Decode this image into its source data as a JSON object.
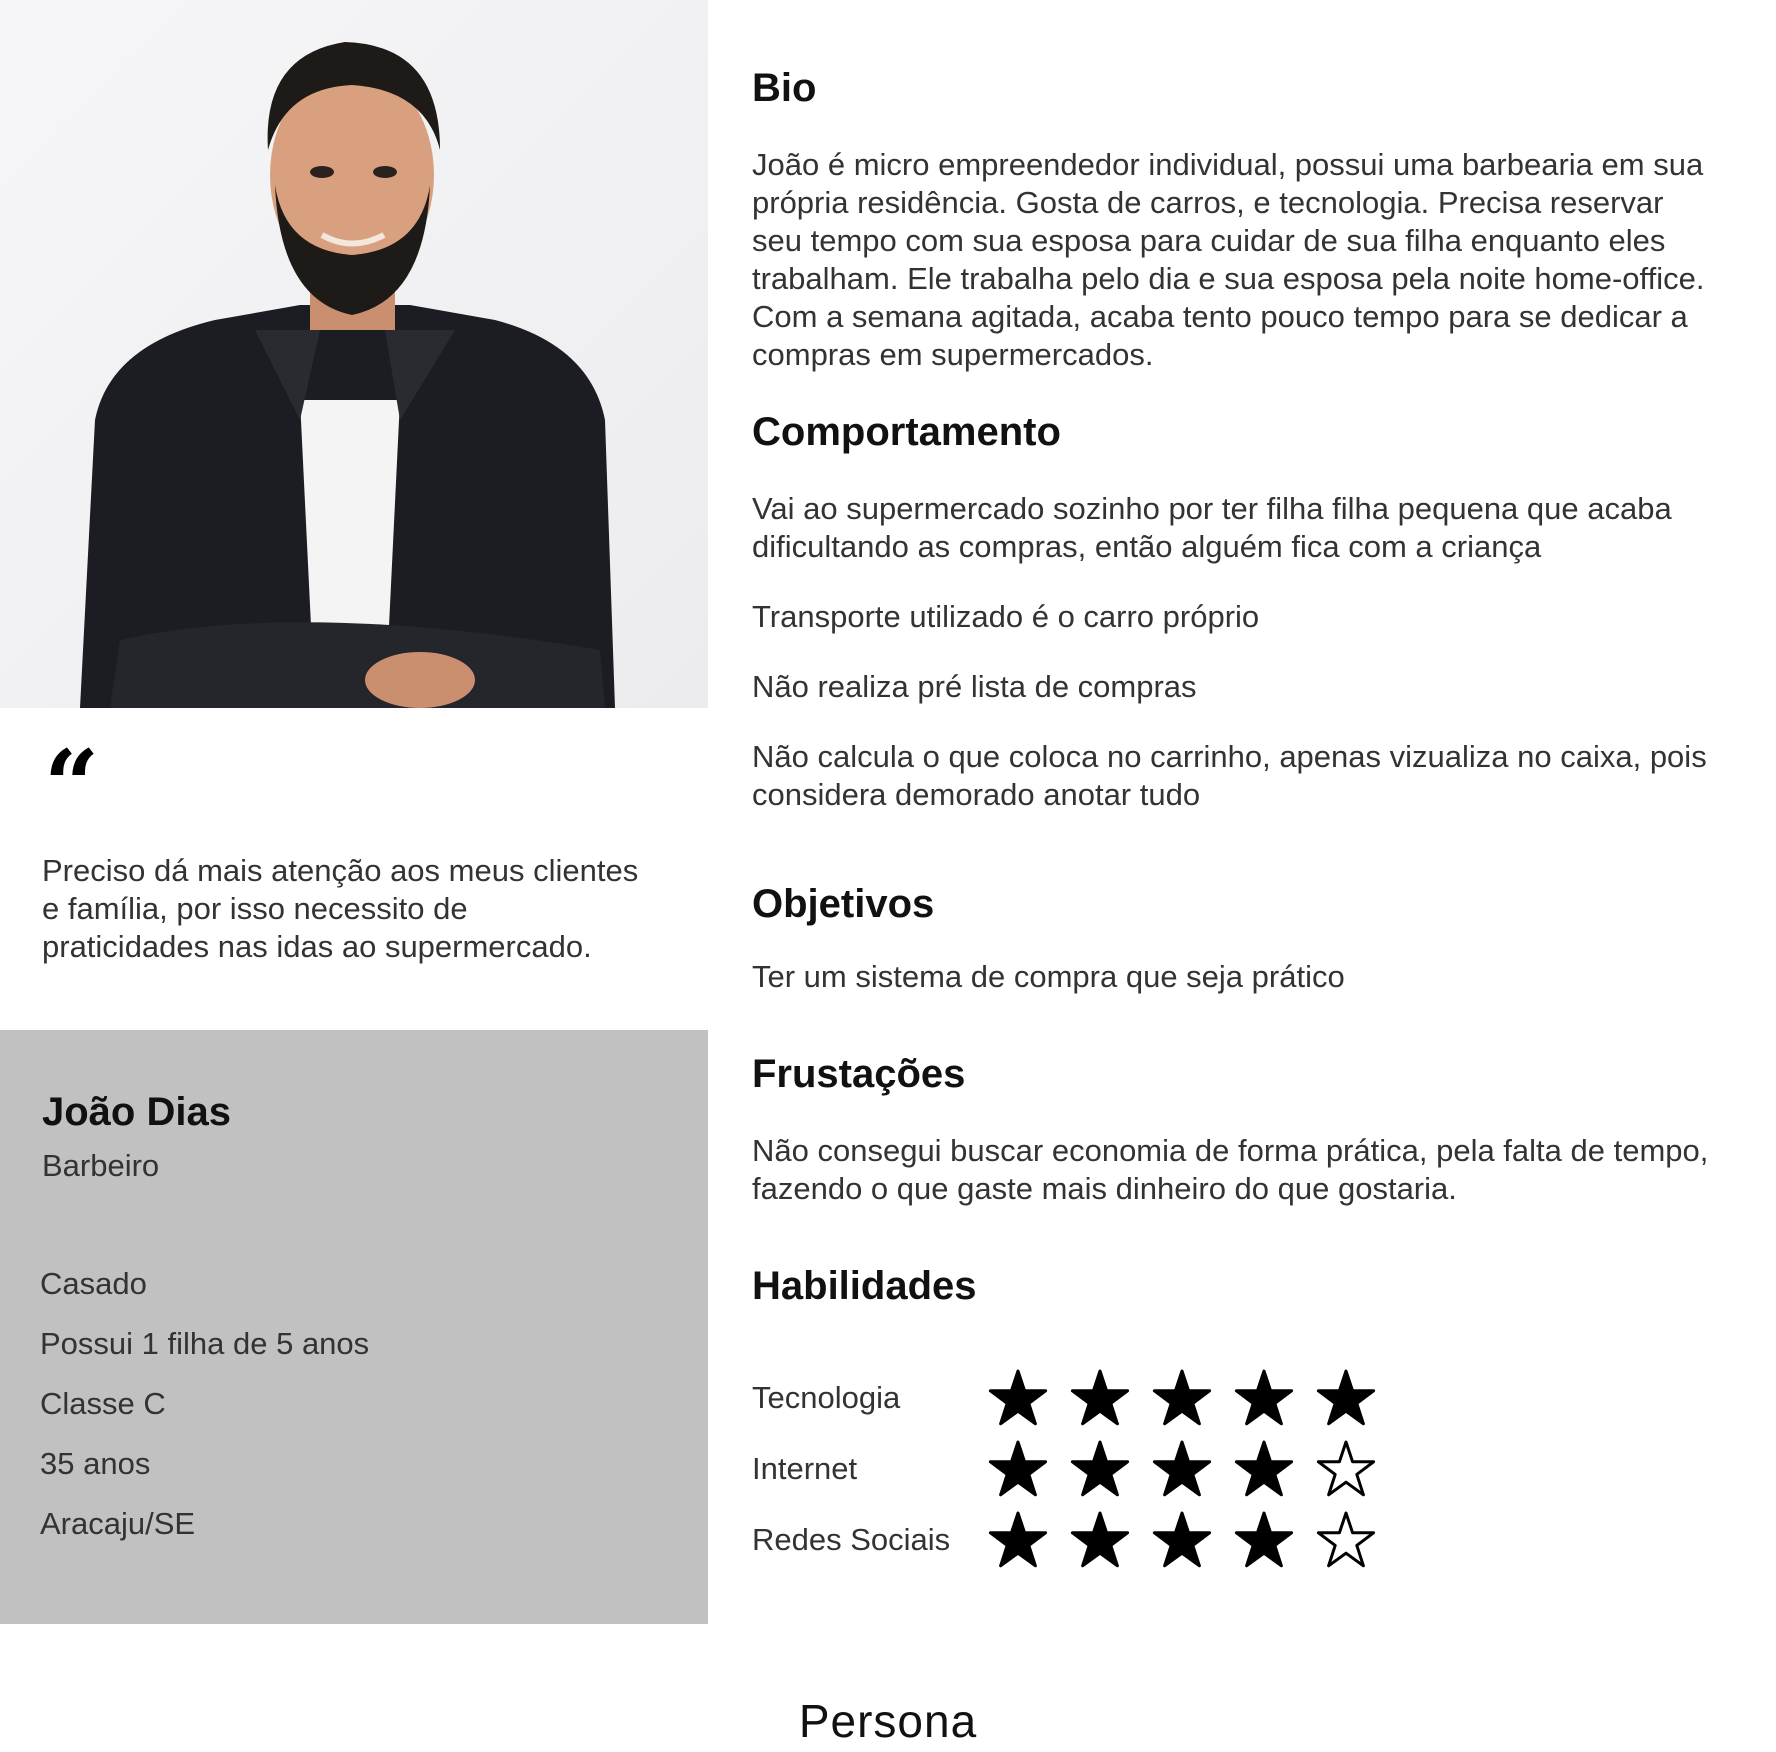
{
  "persona": {
    "name": "João Dias",
    "occupation": "Barbeiro",
    "quote": "Preciso dá mais atenção  aos meus clientes e família,  por isso  necessito de praticidades nas idas ao supermercado.",
    "quote_mark": "“",
    "facts": [
      "Casado",
      "Possui  1 filha de  5 anos",
      "Classe C",
      "35 anos",
      "Aracaju/SE"
    ]
  },
  "sections": {
    "bio": {
      "title": "Bio",
      "text": "João é micro empreendedor individual, possui uma barbearia em sua própria residência. Gosta de carros, e tecnologia. Precisa reservar seu tempo com sua esposa para cuidar de sua filha enquanto eles trabalham. Ele trabalha pelo dia e sua esposa pela noite home-office. Com a semana agitada, acaba tento pouco tempo para se dedicar a compras em supermercados."
    },
    "behavior": {
      "title": "Comportamento",
      "items": [
        "Vai ao supermercado sozinho por ter filha filha pequena que acaba dificultando as compras, então alguém fica com a criança",
        "Transporte utilizado é o carro próprio",
        "Não realiza pré lista de compras",
        "Não calcula o que coloca no carrinho, apenas vizualiza no caixa, pois considera demorado anotar tudo"
      ]
    },
    "goals": {
      "title": "Objetivos",
      "text": "Ter um sistema de compra que seja prático"
    },
    "frustrations": {
      "title": "Frustações",
      "text": "Não consegui buscar economia de forma prática, pela falta de tempo, fazendo o que gaste mais dinheiro do que gostaria."
    },
    "skills": {
      "title": "Habilidades",
      "max": 5,
      "items": [
        {
          "label": "Tecnologia",
          "rating": 5
        },
        {
          "label": "Internet",
          "rating": 4
        },
        {
          "label": "Redes Sociais",
          "rating": 4
        }
      ]
    }
  },
  "footer": {
    "title": "Persona"
  },
  "colors": {
    "info_card_bg": "#c1c1c1",
    "text": "#333333",
    "heading": "#111111",
    "star": "#000000"
  }
}
